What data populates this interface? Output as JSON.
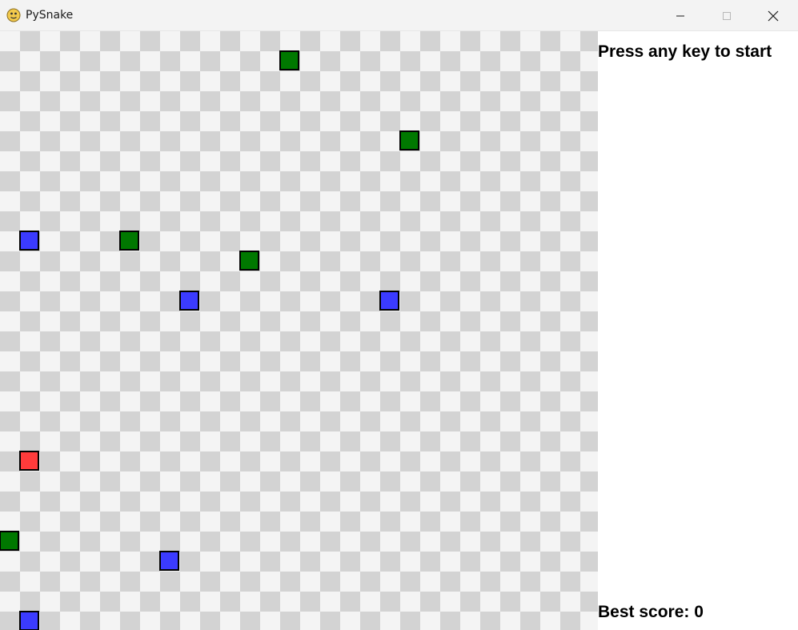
{
  "window": {
    "title": "PySnake",
    "controls": {
      "minimize": "minimize-icon",
      "maximize": "maximize-icon",
      "close": "close-icon"
    }
  },
  "sidebar": {
    "prompt": "Press any key to start",
    "best_score_label": "Best score: 0"
  },
  "game": {
    "grid_columns": 30,
    "colors": {
      "light_tile": "#f4f4f4",
      "dark_tile": "#d3d3d3",
      "food_green": "#007800",
      "obstacle_blue": "#3b3bff",
      "snake_red": "#ff3b3b"
    },
    "green_cells": [
      {
        "col": 14,
        "row": 1
      },
      {
        "col": 20,
        "row": 5
      },
      {
        "col": 6,
        "row": 10
      },
      {
        "col": 12,
        "row": 11
      },
      {
        "col": 0,
        "row": 25
      }
    ],
    "blue_cells": [
      {
        "col": 1,
        "row": 10
      },
      {
        "col": 9,
        "row": 13
      },
      {
        "col": 19,
        "row": 13
      },
      {
        "col": 8,
        "row": 26
      },
      {
        "col": 1,
        "row": 29
      }
    ],
    "red_cells": [
      {
        "col": 1,
        "row": 21
      }
    ]
  }
}
